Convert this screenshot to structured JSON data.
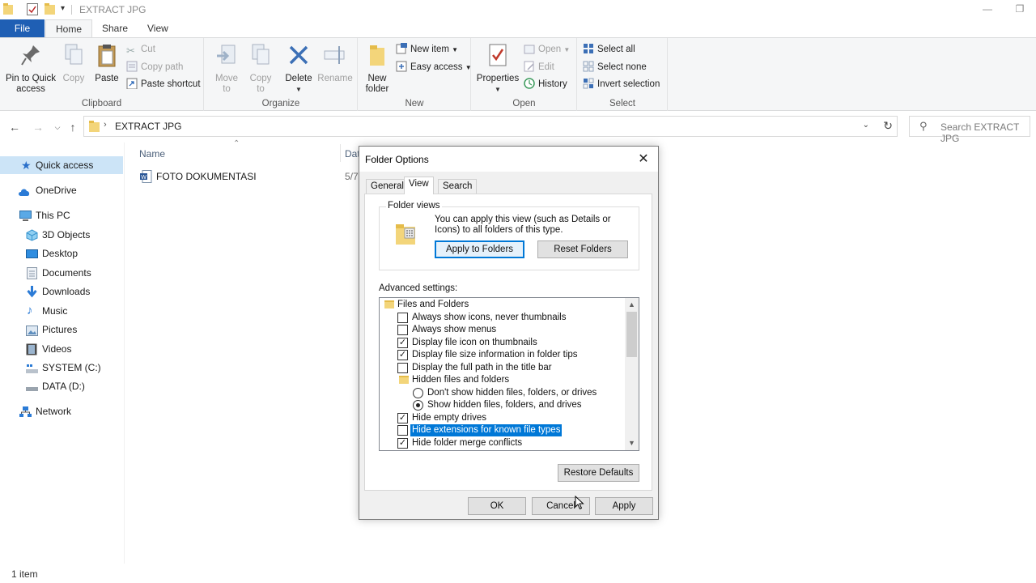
{
  "window": {
    "title": "EXTRACT JPG"
  },
  "ribbon": {
    "tabs": [
      "File",
      "Home",
      "Share",
      "View"
    ],
    "clipboard": {
      "label": "Clipboard",
      "pin": "Pin to Quick\naccess",
      "copy": "Copy",
      "paste": "Paste",
      "cut": "Cut",
      "copy_path": "Copy path",
      "paste_shortcut": "Paste shortcut"
    },
    "organize": {
      "label": "Organize",
      "move_to": "Move\nto",
      "copy_to": "Copy\nto",
      "delete": "Delete",
      "rename": "Rename"
    },
    "new": {
      "label": "New",
      "new_folder": "New\nfolder",
      "new_item": "New item",
      "easy_access": "Easy access"
    },
    "open": {
      "label": "Open",
      "properties": "Properties",
      "open": "Open",
      "edit": "Edit",
      "history": "History"
    },
    "select": {
      "label": "Select",
      "select_all": "Select all",
      "select_none": "Select none",
      "invert": "Invert selection"
    }
  },
  "address": {
    "path": "EXTRACT JPG",
    "search_placeholder": "Search EXTRACT JPG"
  },
  "sidebar": {
    "items": [
      {
        "label": "Quick access",
        "icon": "star-icon"
      },
      {
        "label": "OneDrive",
        "icon": "cloud-icon"
      },
      {
        "label": "This PC",
        "icon": "computer-icon"
      },
      {
        "label": "3D Objects",
        "icon": "cube-icon"
      },
      {
        "label": "Desktop",
        "icon": "desktop-icon"
      },
      {
        "label": "Documents",
        "icon": "document-icon"
      },
      {
        "label": "Downloads",
        "icon": "download-icon"
      },
      {
        "label": "Music",
        "icon": "music-icon"
      },
      {
        "label": "Pictures",
        "icon": "pictures-icon"
      },
      {
        "label": "Videos",
        "icon": "video-icon"
      },
      {
        "label": "SYSTEM (C:)",
        "icon": "drive-icon"
      },
      {
        "label": "DATA (D:)",
        "icon": "drive-icon"
      },
      {
        "label": "Network",
        "icon": "network-icon"
      }
    ]
  },
  "filelist": {
    "columns": [
      "Name",
      "Dat"
    ],
    "rows": [
      {
        "name": "FOTO DOKUMENTASI",
        "date": "5/7"
      }
    ]
  },
  "status": {
    "count": "1 item"
  },
  "dialog": {
    "title": "Folder Options",
    "tabs": [
      "General",
      "View",
      "Search"
    ],
    "folder_views": {
      "label": "Folder views",
      "text": "You can apply this view (such as Details or Icons) to all folders of this type.",
      "apply": "Apply to Folders",
      "reset": "Reset Folders"
    },
    "advanced_label": "Advanced settings:",
    "tree": [
      {
        "kind": "folder",
        "indent": 0,
        "label": "Files and Folders"
      },
      {
        "kind": "check",
        "indent": 1,
        "checked": false,
        "label": "Always show icons, never thumbnails"
      },
      {
        "kind": "check",
        "indent": 1,
        "checked": false,
        "label": "Always show menus"
      },
      {
        "kind": "check",
        "indent": 1,
        "checked": true,
        "label": "Display file icon on thumbnails"
      },
      {
        "kind": "check",
        "indent": 1,
        "checked": true,
        "label": "Display file size information in folder tips"
      },
      {
        "kind": "check",
        "indent": 1,
        "checked": false,
        "label": "Display the full path in the title bar"
      },
      {
        "kind": "folder",
        "indent": 1,
        "label": "Hidden files and folders"
      },
      {
        "kind": "radio",
        "indent": 2,
        "checked": false,
        "label": "Don't show hidden files, folders, or drives"
      },
      {
        "kind": "radio",
        "indent": 2,
        "checked": true,
        "label": "Show hidden files, folders, and drives"
      },
      {
        "kind": "check",
        "indent": 1,
        "checked": true,
        "label": "Hide empty drives"
      },
      {
        "kind": "check",
        "indent": 1,
        "checked": false,
        "label": "Hide extensions for known file types",
        "highlight": true
      },
      {
        "kind": "check",
        "indent": 1,
        "checked": true,
        "label": "Hide folder merge conflicts"
      }
    ],
    "restore_defaults": "Restore Defaults",
    "ok": "OK",
    "cancel": "Cancel",
    "apply": "Apply"
  },
  "colors": {
    "accent": "#0078d7",
    "file_tab": "#1f5fb4",
    "selection": "#cce4f7"
  }
}
